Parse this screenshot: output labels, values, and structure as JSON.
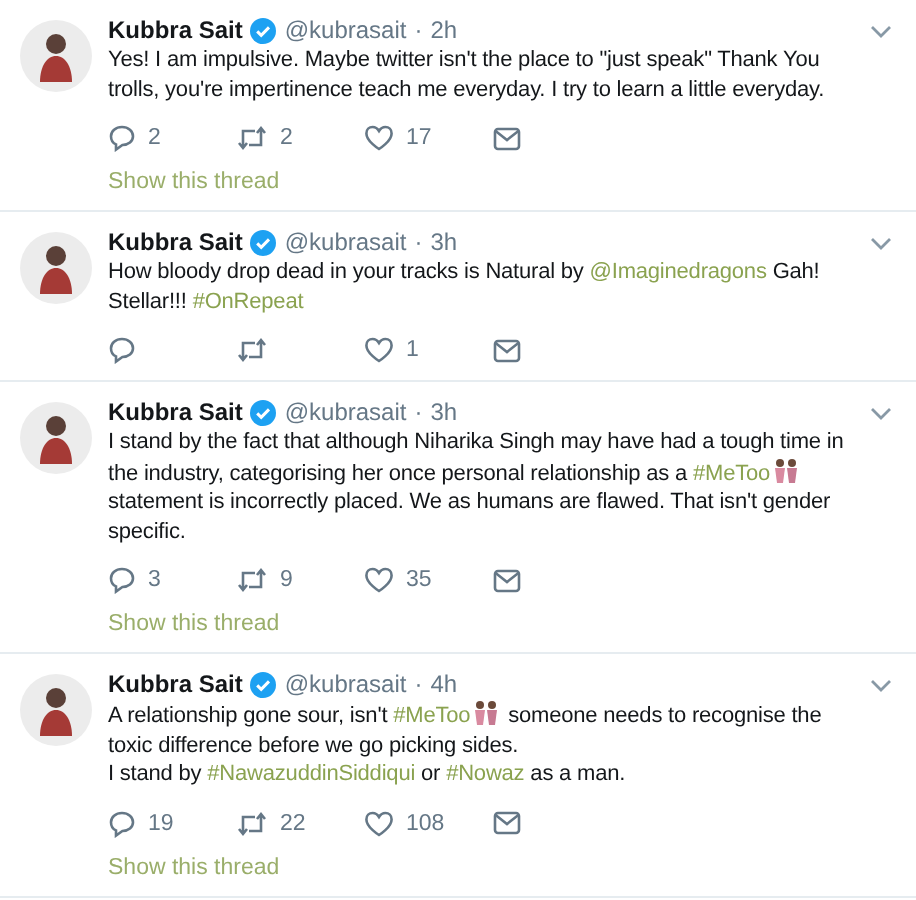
{
  "tweets": [
    {
      "name": "Kubbra Sait",
      "handle": "@kubrasait",
      "separator": "·",
      "time": "2h",
      "paragraphs": [
        [
          {
            "kind": "text",
            "text": "Yes! I am impulsive. Maybe twitter isn't the place to \"just speak\" Thank You trolls, you're impertinence teach me everyday. I try to learn a little everyday."
          }
        ]
      ],
      "actions": [
        {
          "kind": "reply",
          "count": "2"
        },
        {
          "kind": "retweet",
          "count": "2"
        },
        {
          "kind": "like",
          "count": "17"
        },
        {
          "kind": "message"
        }
      ],
      "thread_link": "Show this thread"
    },
    {
      "name": "Kubbra Sait",
      "handle": "@kubrasait",
      "separator": "·",
      "time": "3h",
      "paragraphs": [
        [
          {
            "kind": "text",
            "text": "How bloody drop dead in your tracks is Natural by "
          },
          {
            "kind": "link",
            "text": "@Imaginedragons"
          },
          {
            "kind": "text",
            "text": " Gah! Stellar!!! "
          },
          {
            "kind": "link",
            "text": "#OnRepeat"
          }
        ]
      ],
      "actions": [
        {
          "kind": "reply"
        },
        {
          "kind": "retweet"
        },
        {
          "kind": "like",
          "count": "1"
        },
        {
          "kind": "message"
        }
      ]
    },
    {
      "name": "Kubbra Sait",
      "handle": "@kubrasait",
      "separator": "·",
      "time": "3h",
      "paragraphs": [
        [
          {
            "kind": "text",
            "text": "I stand by the fact that although Niharika Singh may have had a tough time in the industry, categorising her once personal relationship as a "
          },
          {
            "kind": "link",
            "text": "#MeToo"
          },
          {
            "kind": "emoji"
          },
          {
            "kind": "text",
            "text": " statement is incorrectly placed. We as humans are flawed. That isn't gender specific."
          }
        ]
      ],
      "actions": [
        {
          "kind": "reply",
          "count": "3"
        },
        {
          "kind": "retweet",
          "count": "9"
        },
        {
          "kind": "like",
          "count": "35"
        },
        {
          "kind": "message"
        }
      ],
      "thread_link": "Show this thread"
    },
    {
      "name": "Kubbra Sait",
      "handle": "@kubrasait",
      "separator": "·",
      "time": "4h",
      "paragraphs": [
        [
          {
            "kind": "text",
            "text": "A relationship gone sour, isn't "
          },
          {
            "kind": "link",
            "text": "#MeToo"
          },
          {
            "kind": "emoji"
          },
          {
            "kind": "text",
            "text": " someone needs to recognise the toxic difference before we go picking sides."
          }
        ],
        [
          {
            "kind": "text",
            "text": "I stand by "
          },
          {
            "kind": "link",
            "text": "#NawazuddinSiddiqui"
          },
          {
            "kind": "text",
            "text": " or "
          },
          {
            "kind": "link",
            "text": "#Nowaz"
          },
          {
            "kind": "text",
            "text": " as a man."
          }
        ]
      ],
      "actions": [
        {
          "kind": "reply",
          "count": "19"
        },
        {
          "kind": "retweet",
          "count": "22"
        },
        {
          "kind": "like",
          "count": "108"
        },
        {
          "kind": "message"
        }
      ],
      "thread_link": "Show this thread"
    }
  ]
}
